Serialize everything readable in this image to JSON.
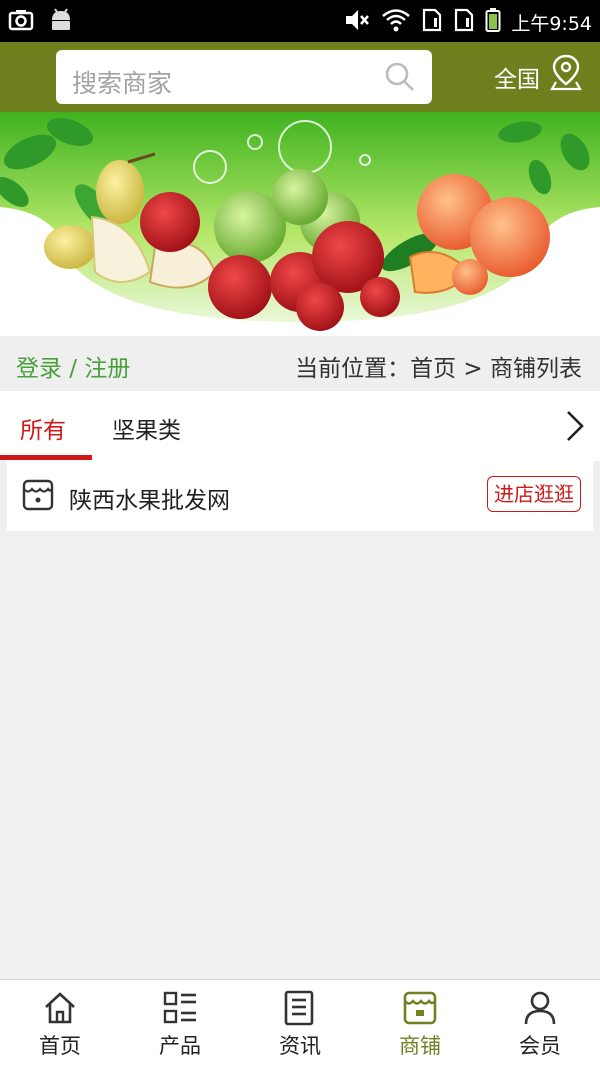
{
  "status_bar": {
    "time": "上午9:54"
  },
  "header": {
    "search_placeholder": "搜索商家",
    "region_label": "全国"
  },
  "colors": {
    "header_bg": "#6f7f1e",
    "accent_green": "#4aa03a",
    "active_red": "#d01818",
    "nav_active": "#6f8222"
  },
  "info_bar": {
    "login_register": "登录 / 注册",
    "breadcrumb": "当前位置：首页 > 商铺列表"
  },
  "tabs": {
    "items": [
      {
        "label": "所有",
        "active": true
      },
      {
        "label": "坚果类",
        "active": false
      }
    ]
  },
  "shops": [
    {
      "name": "陕西水果批发网",
      "button_label": "进店逛逛",
      "icon": "shop-icon"
    }
  ],
  "bottom_nav": {
    "items": [
      {
        "label": "首页",
        "icon": "home-icon",
        "active": false
      },
      {
        "label": "产品",
        "icon": "grid-list-icon",
        "active": false
      },
      {
        "label": "资讯",
        "icon": "document-icon",
        "active": false
      },
      {
        "label": "商铺",
        "icon": "store-icon",
        "active": true
      },
      {
        "label": "会员",
        "icon": "user-icon",
        "active": false
      }
    ]
  }
}
